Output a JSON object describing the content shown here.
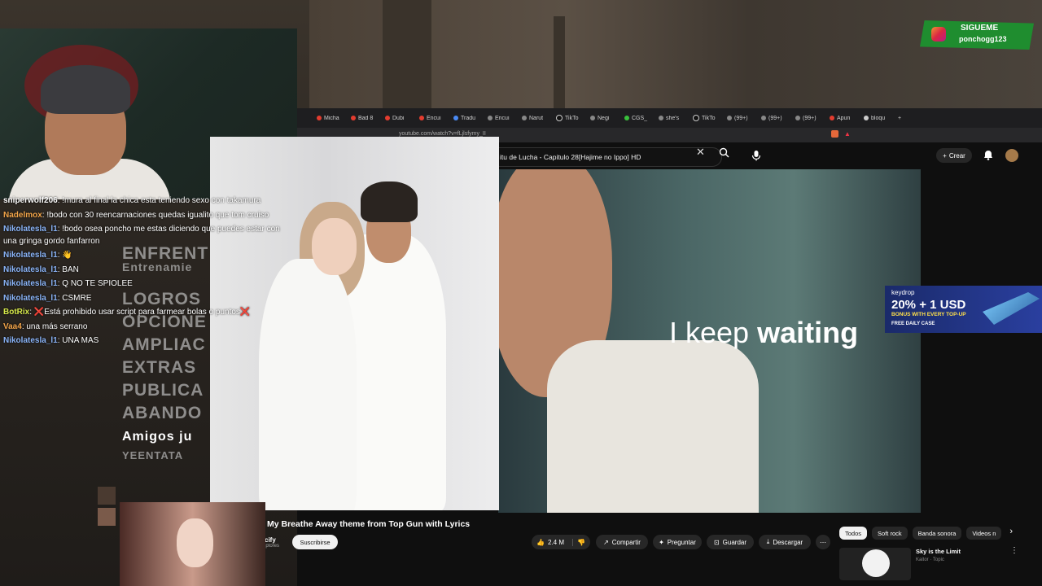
{
  "browser": {
    "tabs": [
      "Micha",
      "Bad 8",
      "Dubi",
      "Encui",
      "Tradu",
      "Encui",
      "Narut",
      "TikTo",
      "Negi",
      "CGS_",
      "she's",
      "TikTo",
      "(99+)",
      "(99+)",
      "(99+)",
      "Apun",
      "bloqu"
    ],
    "url": "youtube.com/watch?v=fLjlsfymy_II"
  },
  "youtube": {
    "search_text": "itu de Lucha - Capitulo 28[Hajime no Ippo] HD",
    "create_label": "Crear",
    "subtitle_light": "I keep ",
    "subtitle_bold": "waiting",
    "video_title": "My Breathe Away theme from Top Gun with Lyrics",
    "channel_name": "cify",
    "channel_subs": "iptores",
    "subscribe_label": "Suscribirse",
    "likes": "2.4 M",
    "share_label": "Compartir",
    "ask_label": "Preguntar",
    "save_label": "Guardar",
    "download_label": "Descargar",
    "chips": [
      "Todos",
      "Soft rock",
      "Banda sonora",
      "Videos n"
    ],
    "rec_title": "Sky is the Limit",
    "rec_channel": "Kaitor · Topic"
  },
  "chat": [
    {
      "user": "sniperwolf206",
      "user_color": "#ffffff",
      "text": ": !mura al final la chica esta teniendo sexo con takamura"
    },
    {
      "user": "Nadelmox",
      "user_color": "#f3a54a",
      "text": ": !bodo con 30 reencarnaciones quedas igualito que tom cruiso"
    },
    {
      "user": "Nikolatesla_l1",
      "user_color": "#8ab4f8",
      "text": ": !bodo osea poncho me estas diciendo que puedes estar con una gringa gordo fanfarron"
    },
    {
      "user": "Nikolatesla_l1",
      "user_color": "#8ab4f8",
      "text": ": 👋"
    },
    {
      "user": "Nikolatesla_l1",
      "user_color": "#8ab4f8",
      "text": ": BAN"
    },
    {
      "user": "Nikolatesla_l1",
      "user_color": "#8ab4f8",
      "text": ": Q NO TE SPIOLEE"
    },
    {
      "user": "Nikolatesla_l1",
      "user_color": "#8ab4f8",
      "text": ": CSMRE"
    },
    {
      "user": "BotRix",
      "user_color": "#d6e84a",
      "text": ": ❌Está prohibido usar script para farmear bolas o puntos❌"
    },
    {
      "user": "Vaa4",
      "user_color": "#f3a54a",
      "text": ": una más serrano"
    },
    {
      "user": "Nikolatesla_l1",
      "user_color": "#8ab4f8",
      "text": ": UNA MAS"
    }
  ],
  "background_menu": [
    "ENFRENT",
    "Entrenamie",
    "LOGROS",
    "OPCIONE",
    "AMPLIAC",
    "EXTRAS",
    "PUBLICA",
    "ABANDO",
    "Amigos ju",
    "YEENTATA"
  ],
  "overlay": {
    "sigueme_title": "SIGUEME",
    "sigueme_user": "ponchogg123",
    "keydrop_brand": "keydrop",
    "keydrop_headline": "20% + 1 USD",
    "keydrop_sub": "BONUS WITH EVERY TOP-UP",
    "keydrop_case": "FREE DAILY CASE"
  }
}
